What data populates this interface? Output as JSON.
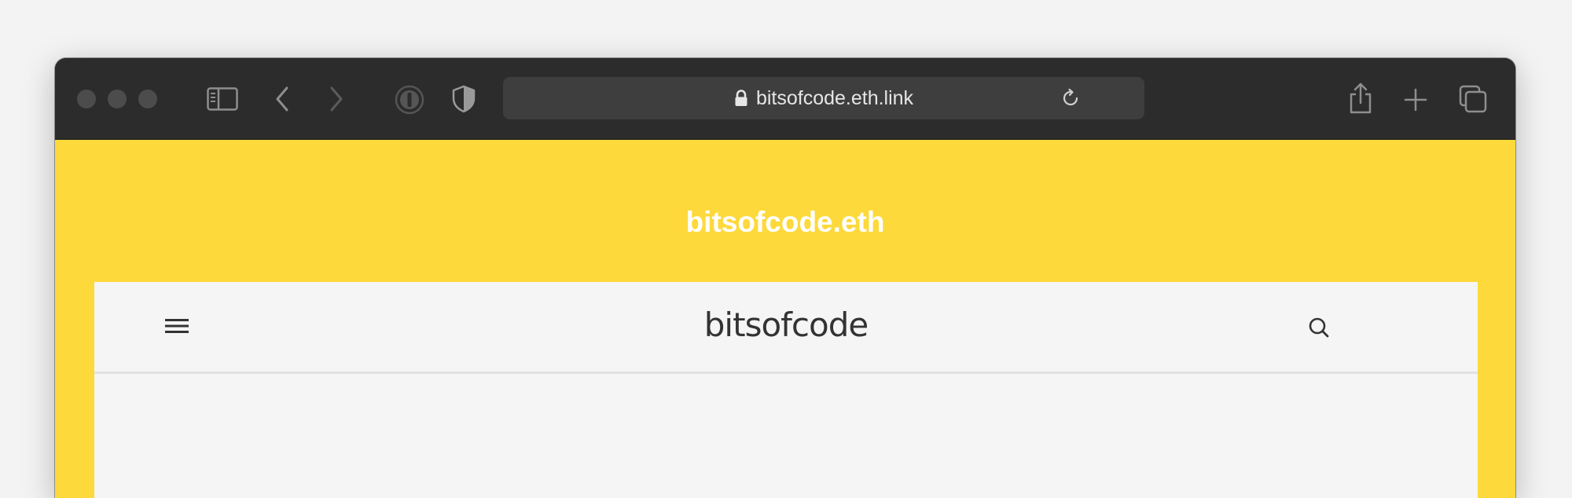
{
  "browser": {
    "address_text": "bitsofcode.eth.link",
    "icons": {
      "traffic_lights": [
        "close-button",
        "minimize-button",
        "zoom-button"
      ],
      "sidebar": "sidebar-icon",
      "back": "chevron-left-icon",
      "forward": "chevron-right-icon",
      "password_manager": "1password-icon",
      "shield": "shield-icon",
      "lock": "lock-icon",
      "reload": "reload-icon",
      "share": "share-icon",
      "new_tab": "plus-icon",
      "tabs": "tabs-overview-icon"
    }
  },
  "page": {
    "site_title": "bitsofcode.eth",
    "logo_text": "bitsofcode",
    "icons": {
      "menu": "hamburger-menu-icon",
      "search": "search-icon"
    },
    "colors": {
      "background": "#fdd93b",
      "panel": "#f5f5f5",
      "title_text": "#ffffff",
      "logo_text": "#333333"
    }
  }
}
